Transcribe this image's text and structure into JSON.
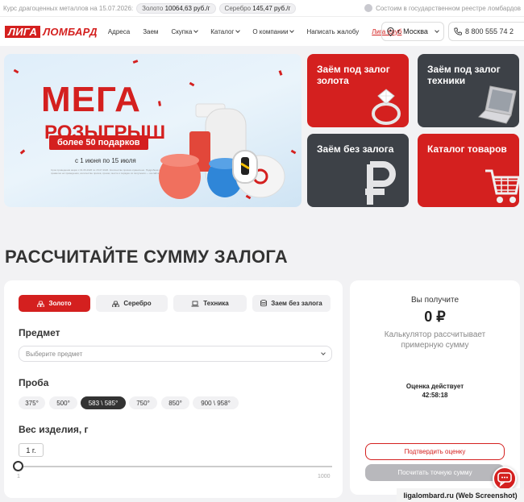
{
  "topbar": {
    "rates_label": "Курс драгоценных металлов на 15.07.2026:",
    "gold_label": "Золото",
    "gold_value": "10064,63 руб./г",
    "silver_label": "Серебро",
    "silver_value": "145,47 руб./г",
    "registry_text": "Состоим в государственном реестре ломбардов"
  },
  "nav": {
    "logo_part1": "ЛИГА",
    "logo_part2": "ЛОМБАРД",
    "items": [
      {
        "label": "Адреса"
      },
      {
        "label": "Заем"
      },
      {
        "label": "Скупка"
      },
      {
        "label": "Каталог"
      },
      {
        "label": "О компании"
      },
      {
        "label": "Написать жалобу"
      },
      {
        "label": "Лига Клуб"
      }
    ],
    "city": "г. Москва",
    "phone": "8 800 555 74 2"
  },
  "hero": {
    "title": "МЕГА",
    "subtitle": "РОЗЫГРЫШ",
    "badge": "более 50 подарков",
    "dates": "с 1 июня по 15 июля",
    "fine_print": "Срок проведения акции с 01.06.2026 по 15.07.2026. Количество призов ограничено. Подробная информация об организаторе акции, правилах её проведения, количестве призов, сроках, месте и порядке их получения — на сайте ligalombard.ru"
  },
  "cards": [
    {
      "title": "Заём под залог золота",
      "color": "#d4201f",
      "icon": "diamond-ring-icon"
    },
    {
      "title": "Заём под залог техники",
      "color": "#3d4147",
      "icon": "laptop-icon"
    },
    {
      "title": "Заём без залога",
      "color": "#3d4147",
      "icon": "ruble-icon"
    },
    {
      "title": "Каталог товаров",
      "color": "#d4201f",
      "icon": "shopping-cart-icon"
    }
  ],
  "calculator": {
    "heading": "РАССЧИТАЙТЕ СУММУ ЗАЛОГА",
    "tabs": [
      {
        "label": "Золото",
        "active": true
      },
      {
        "label": "Серебро"
      },
      {
        "label": "Техника"
      },
      {
        "label": "Заем без залога"
      }
    ],
    "item_label": "Предмет",
    "item_placeholder": "Выберите предмет",
    "probe_label": "Проба",
    "probes": [
      "375°",
      "500°",
      "583 \\ 585°",
      "750°",
      "850°",
      "900 \\ 958°"
    ],
    "selected_probe": "583 \\ 585°",
    "weight_label": "Вес изделия, г",
    "weight_value": "1 г.",
    "slider_min": "1",
    "slider_max": "1000",
    "slider_value": 1
  },
  "result": {
    "you_get": "Вы получите",
    "amount": "0 ₽",
    "note": "Калькулятор рассчитывает примерную сумму",
    "valid_label": "Оценка действует",
    "timer": "42:58:18",
    "confirm_button": "Подтвердить оценку",
    "exact_button": "Посчитать точную сумму"
  },
  "watermark": "ligalombard.ru (Web Screenshot)",
  "colors": {
    "accent": "#d4201f",
    "dark": "#3d4147",
    "background": "#f2f2f4"
  }
}
